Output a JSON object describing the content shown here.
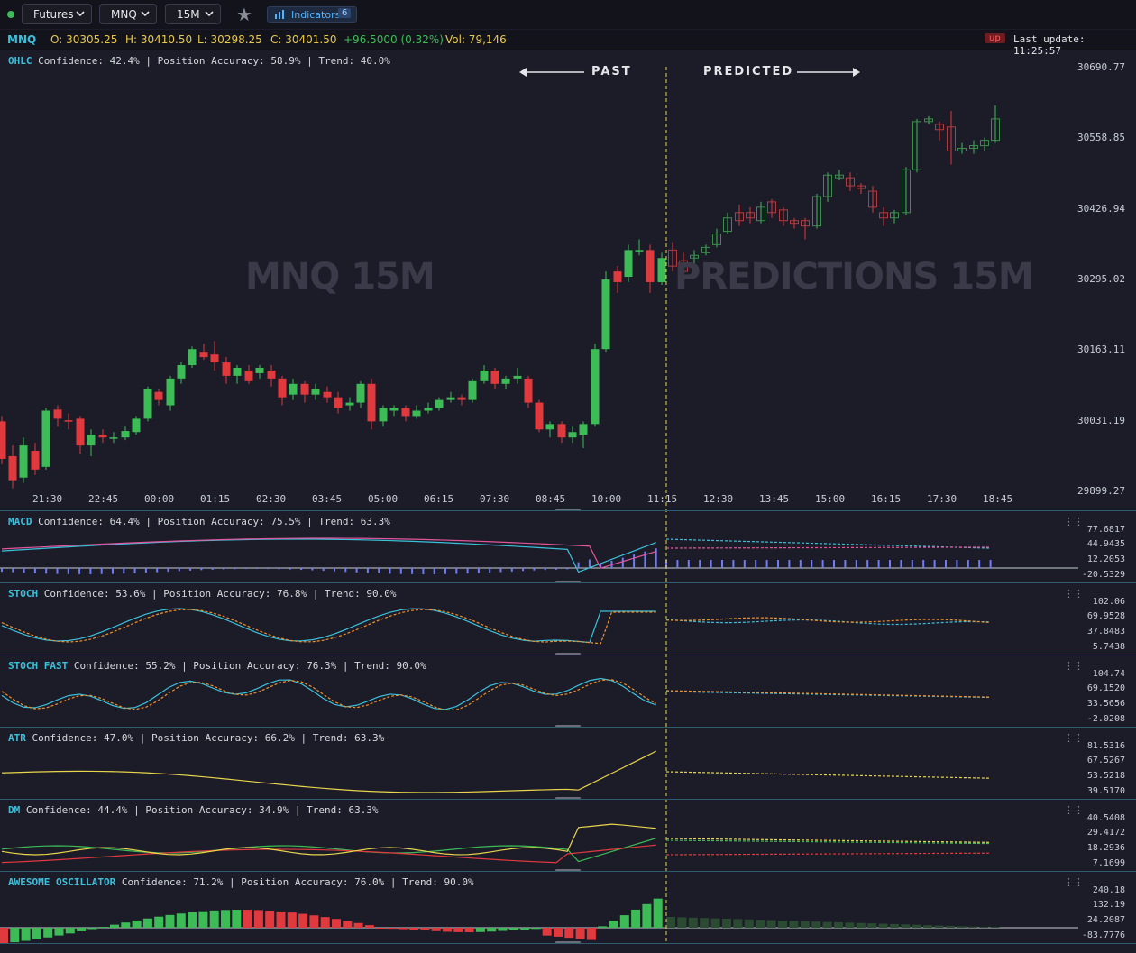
{
  "toolbar": {
    "market_select": "Futures",
    "symbol_select": "MNQ",
    "interval_select": "15M",
    "indicators_label": "Indicators",
    "indicators_count": "6"
  },
  "info": {
    "symbol": "MNQ",
    "open": "O: 30305.25",
    "high": "H: 30410.50",
    "low": "L: 30298.25",
    "close": "C: 30401.50",
    "change": "+96.5000 (0.32%)",
    "volume": "Vol: 79,146",
    "direction": "up",
    "last_update": "Last update: 11:25:57"
  },
  "main_chart": {
    "tag": "OHLC",
    "stats": "Confidence: 42.4% | Position Accuracy: 58.9% | Trend: 40.0%",
    "past_label": "PAST",
    "predicted_label": "PREDICTED",
    "watermark_left": "MNQ 15M",
    "watermark_right": "PREDICTIONS 15M",
    "y_ticks": [
      "30690.77",
      "30558.85",
      "30426.94",
      "30295.02",
      "30163.11",
      "30031.19",
      "29899.27"
    ],
    "x_ticks": [
      "21:30",
      "22:45",
      "00:00",
      "01:15",
      "02:30",
      "03:45",
      "05:00",
      "06:15",
      "07:30",
      "08:45",
      "10:00",
      "11:15",
      "12:30",
      "13:45",
      "15:00",
      "16:15",
      "17:30",
      "18:45"
    ]
  },
  "panels": [
    {
      "tag": "MACD",
      "stats": "Confidence: 64.4% | Position Accuracy: 75.5% | Trend: 63.3%",
      "y_ticks": [
        "77.6817",
        "44.9435",
        "12.2053",
        "-20.5329"
      ]
    },
    {
      "tag": "STOCH",
      "stats": "Confidence: 53.6% | Position Accuracy: 76.8% | Trend: 90.0%",
      "y_ticks": [
        "102.06",
        "69.9528",
        "37.8483",
        "5.7438"
      ]
    },
    {
      "tag": "STOCH FAST",
      "stats": "Confidence: 55.2% | Position Accuracy: 76.3% | Trend: 90.0%",
      "y_ticks": [
        "104.74",
        "69.1520",
        "33.5656",
        "-2.0208"
      ]
    },
    {
      "tag": "ATR",
      "stats": "Confidence: 47.0% | Position Accuracy: 66.2% | Trend: 63.3%",
      "y_ticks": [
        "81.5316",
        "67.5267",
        "53.5218",
        "39.5170"
      ]
    },
    {
      "tag": "DM",
      "stats": "Confidence: 44.4% | Position Accuracy: 34.9% | Trend: 63.3%",
      "y_ticks": [
        "40.5408",
        "29.4172",
        "18.2936",
        "7.1699"
      ]
    },
    {
      "tag": "AWESOME OSCILLATOR",
      "stats": "Confidence: 71.2% | Position Accuracy: 76.0% | Trend: 90.0%",
      "y_ticks": [
        "240.18",
        "132.19",
        "24.2087",
        "-83.7776"
      ]
    }
  ],
  "colors": {
    "bull": "#3dbb56",
    "bear": "#e0393e",
    "accent": "#3bc0dc",
    "divider": "#e8d44d",
    "macd_line": "#3bc0dc",
    "signal_line": "#e0569a",
    "stoch_k": "#3bc0dc",
    "stoch_d": "#f0902a",
    "atr": "#e8d44d",
    "dm_plus": "#3dbb56",
    "dm_minus": "#e0393e",
    "adx": "#e8d44d"
  }
}
